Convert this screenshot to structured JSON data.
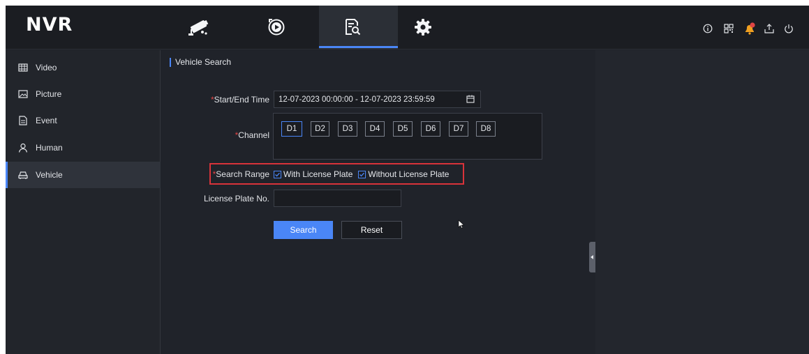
{
  "app": {
    "title": "NVR"
  },
  "top_nav": {
    "tabs": [
      {
        "icon": "camera-icon",
        "active": false
      },
      {
        "icon": "playback-icon",
        "active": false
      },
      {
        "icon": "file-search-icon",
        "active": true
      },
      {
        "icon": "gear-icon",
        "active": false
      }
    ],
    "actions": [
      "info-icon",
      "qr-code-icon",
      "alarm-bell-icon",
      "download-icon",
      "power-icon"
    ],
    "accent": "#4a86f7"
  },
  "sidebar": {
    "items": [
      {
        "label": "Video",
        "icon": "video-icon",
        "active": false
      },
      {
        "label": "Picture",
        "icon": "picture-icon",
        "active": false
      },
      {
        "label": "Event",
        "icon": "event-icon",
        "active": false
      },
      {
        "label": "Human",
        "icon": "human-icon",
        "active": false
      },
      {
        "label": "Vehicle",
        "icon": "vehicle-icon",
        "active": true
      }
    ]
  },
  "main": {
    "section_title": "Vehicle Search",
    "required_mark": "*",
    "start_end_time": {
      "label": "Start/End Time",
      "value": "12-07-2023 00:00:00 - 12-07-2023 23:59:59"
    },
    "channel": {
      "label": "Channel",
      "options": [
        "D1",
        "D2",
        "D3",
        "D4",
        "D5",
        "D6",
        "D7",
        "D8"
      ],
      "selected": "D1"
    },
    "search_range": {
      "label": "Search Range",
      "options": [
        {
          "label": "With License Plate",
          "checked": true
        },
        {
          "label": "Without License Plate",
          "checked": true
        }
      ]
    },
    "license_plate": {
      "label": "License Plate No.",
      "value": ""
    },
    "buttons": {
      "search": "Search",
      "reset": "Reset"
    }
  }
}
